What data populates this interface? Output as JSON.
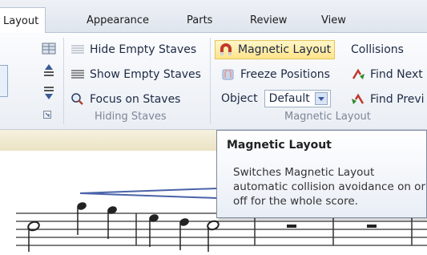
{
  "tabs": [
    "Layout",
    "Appearance",
    "Parts",
    "Review",
    "View"
  ],
  "hiding_staves": {
    "items": [
      "Hide Empty Staves",
      "Show Empty Staves",
      "Focus on Staves"
    ],
    "group_label": "Hiding Staves"
  },
  "magnetic_layout": {
    "magnetic_layout_label": "Magnetic Layout",
    "freeze_positions_label": "Freeze Positions",
    "object_label": "Object",
    "object_value": "Default",
    "collisions_label": "Collisions",
    "find_next_label": "Find Next",
    "find_previous_label": "Find Previ",
    "group_label": "Magnetic Layout"
  },
  "tooltip": {
    "title": "Magnetic Layout",
    "body": "Switches Magnetic Layout automatic collision avoidance on or off for the whole score."
  }
}
